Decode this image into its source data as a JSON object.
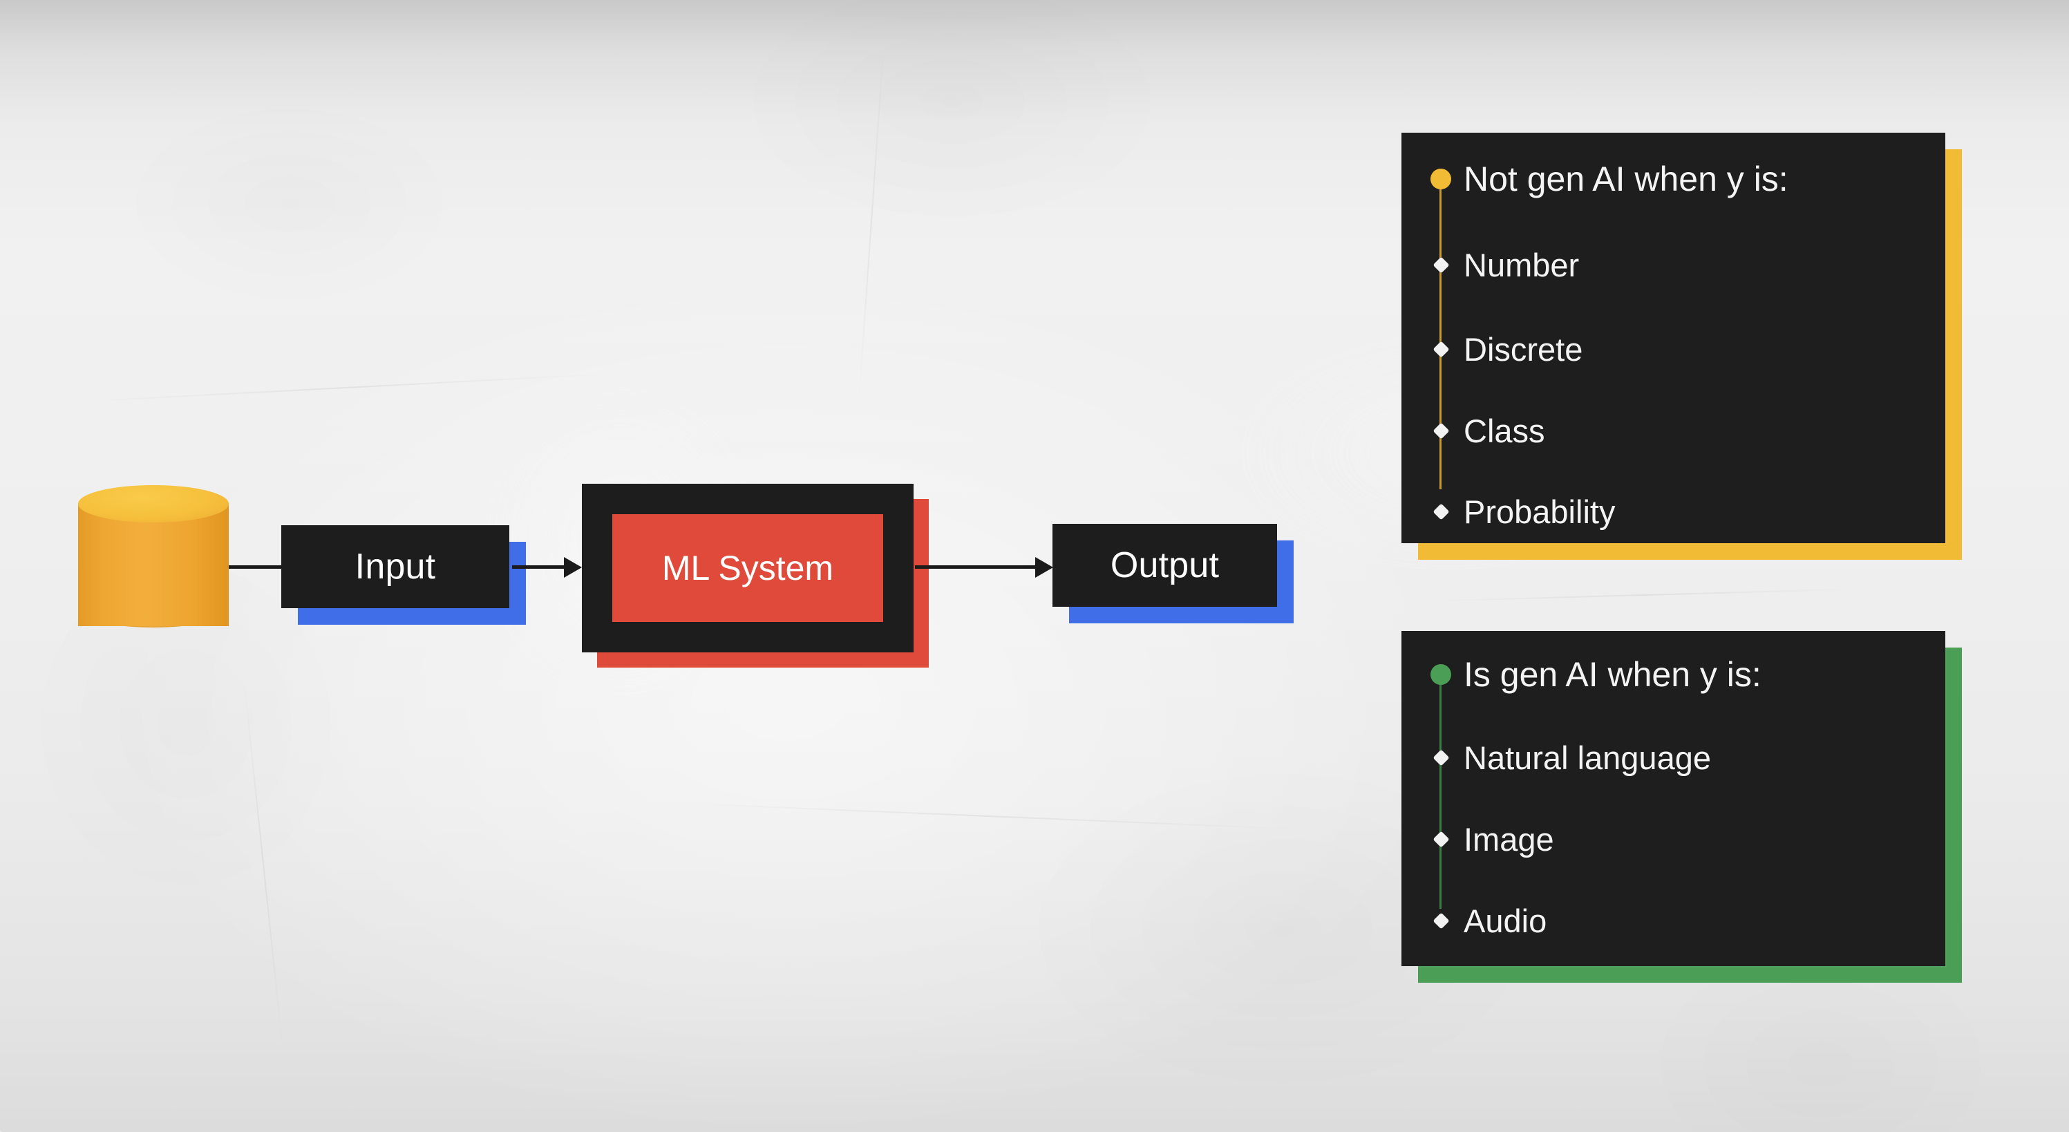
{
  "slide": {
    "background_color": "#efefef",
    "panel_color": "#1e1e1e"
  },
  "flow": {
    "datastore": {
      "name": "database-cylinder",
      "color": "#efa733"
    },
    "nodes": [
      {
        "id": "input",
        "label": "Input",
        "shadow_color": "#3f6ee8"
      },
      {
        "id": "ml-system",
        "label": "ML System",
        "shadow_color": "#df4a3a",
        "inner_color": "#df4a3a"
      },
      {
        "id": "output",
        "label": "Output",
        "shadow_color": "#3f6ee8"
      }
    ],
    "connectors": [
      {
        "from": "datastore",
        "to": "input"
      },
      {
        "from": "input",
        "to": "ml-system"
      },
      {
        "from": "ml-system",
        "to": "output"
      }
    ]
  },
  "cards": [
    {
      "id": "not-gen-ai",
      "accent_color": "#f2bb35",
      "heading": "Not gen AI when y is:",
      "items": [
        "Number",
        "Discrete",
        "Class",
        "Probability"
      ]
    },
    {
      "id": "is-gen-ai",
      "accent_color": "#4a9e55",
      "heading": "Is gen AI when y is:",
      "items": [
        "Natural language",
        "Image",
        "Audio"
      ]
    }
  ]
}
